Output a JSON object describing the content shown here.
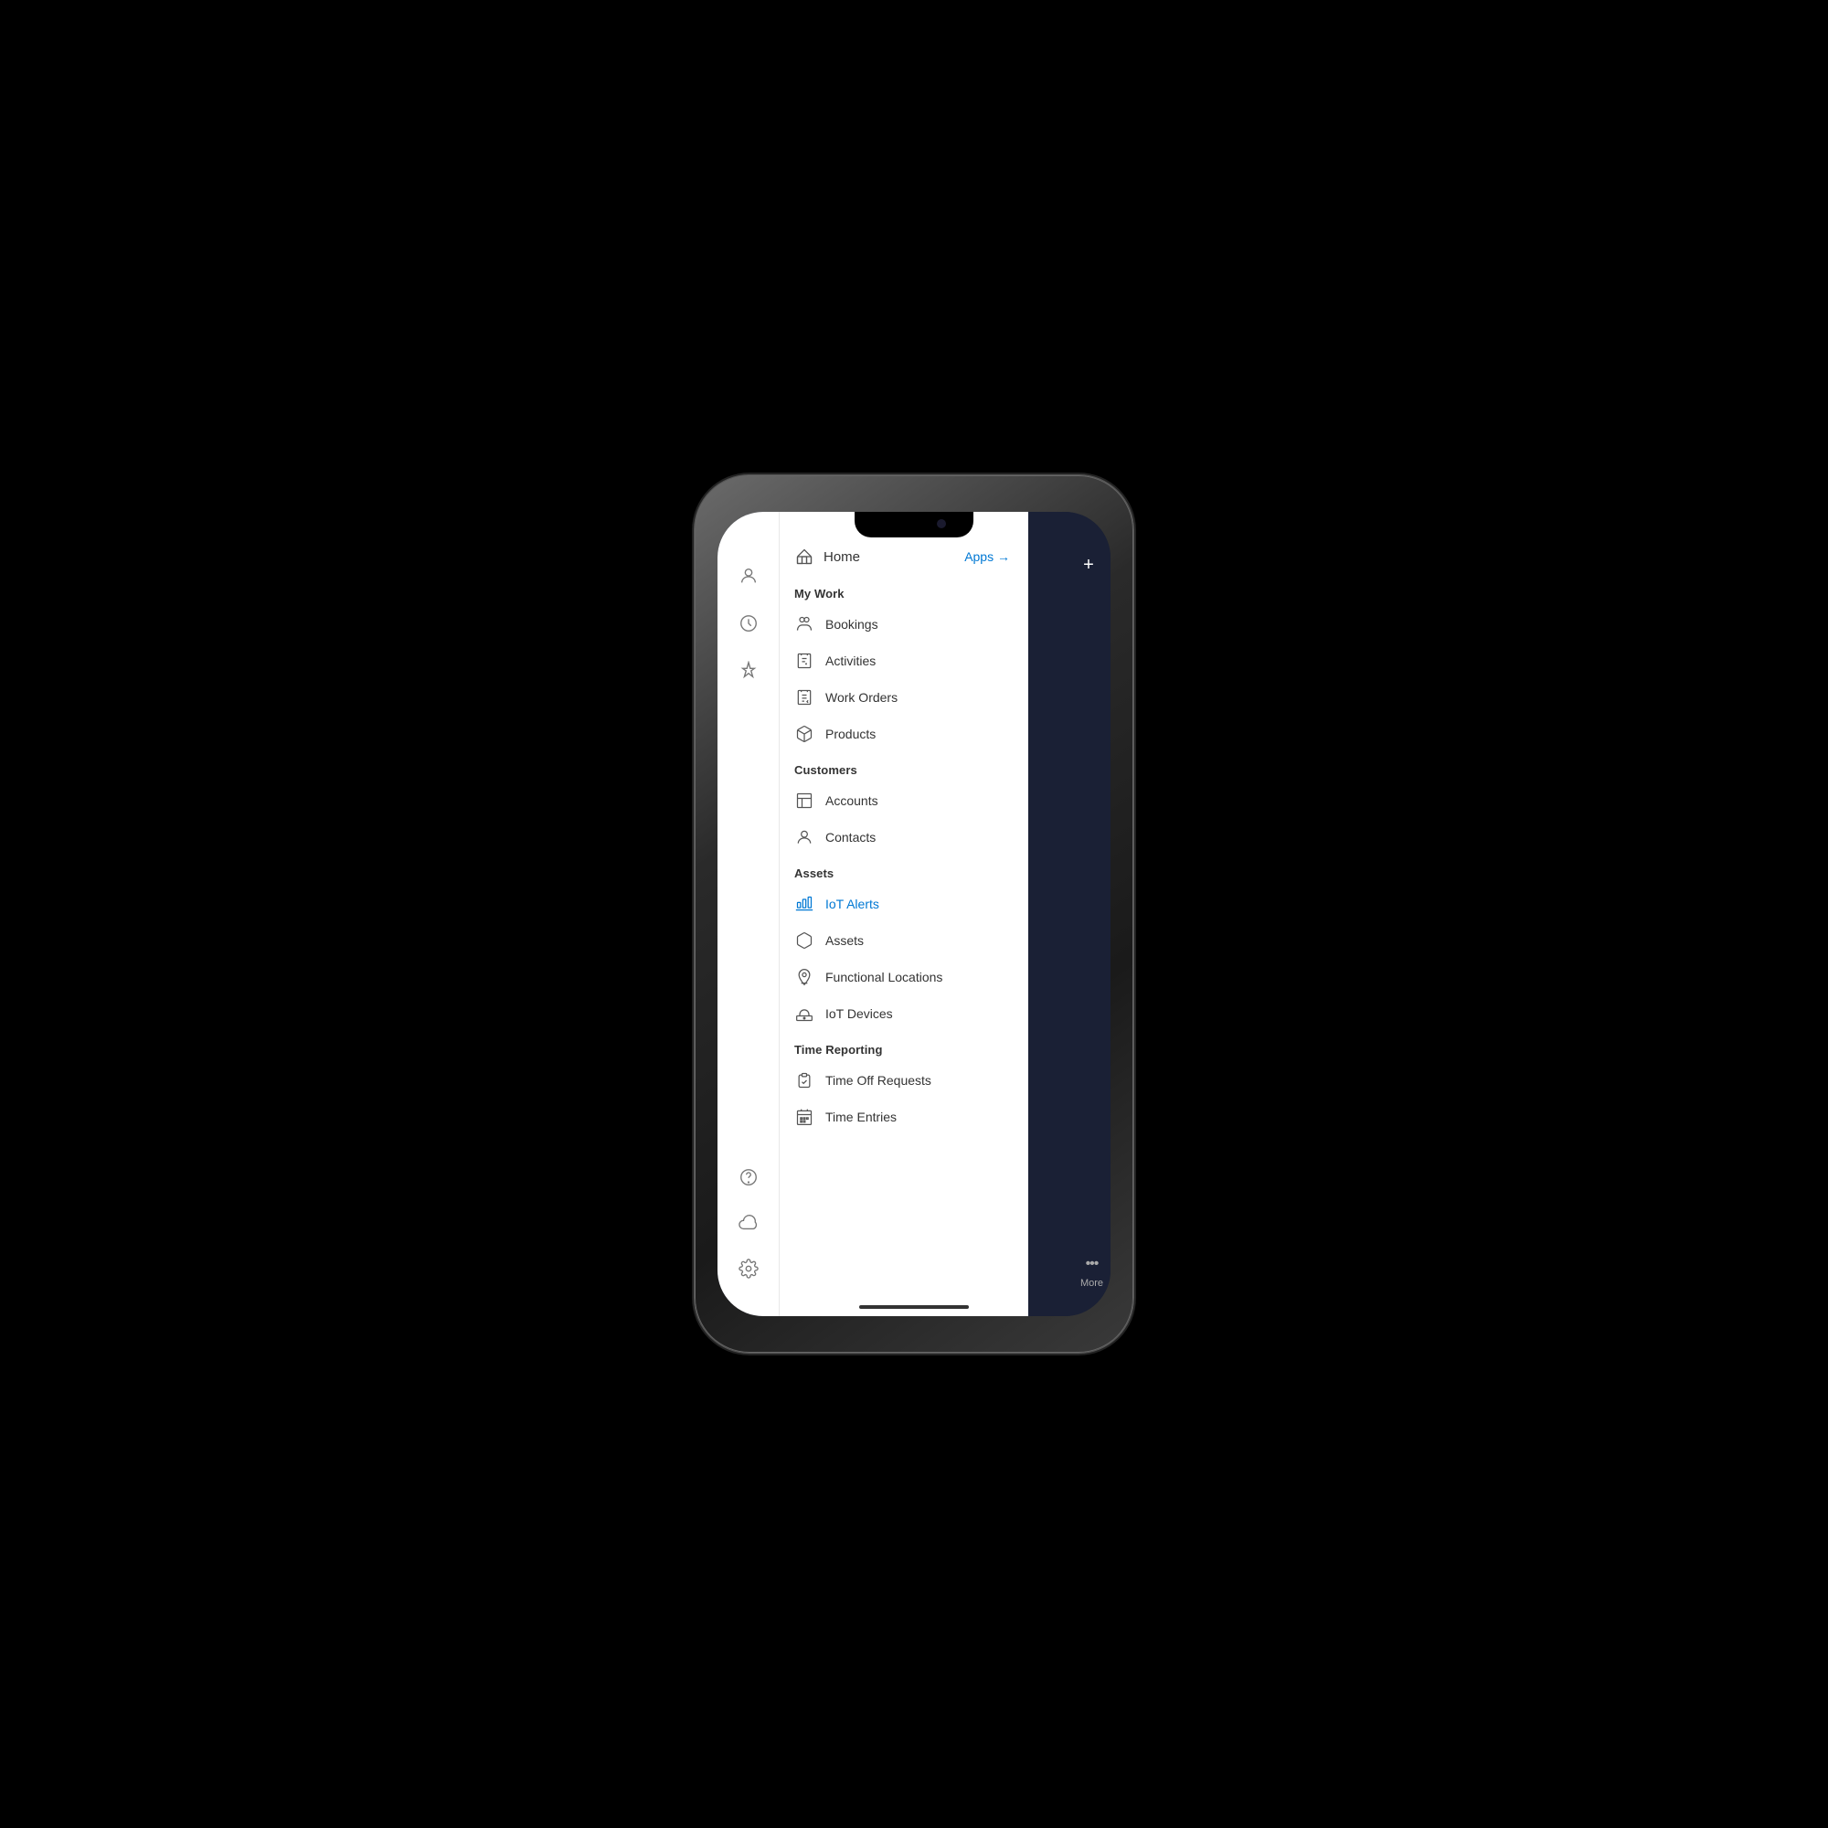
{
  "phone": {
    "notch": true
  },
  "header": {
    "home_label": "Home",
    "apps_label": "Apps →",
    "plus_label": "+"
  },
  "sidebar_icons": [
    {
      "name": "person-icon",
      "symbol": "👤"
    },
    {
      "name": "clock-icon",
      "symbol": "🕐"
    },
    {
      "name": "pin-icon",
      "symbol": "📌"
    }
  ],
  "sidebar_bottom_icons": [
    {
      "name": "help-icon",
      "symbol": "?"
    },
    {
      "name": "cloud-icon",
      "symbol": "☁"
    },
    {
      "name": "settings-icon",
      "symbol": "⚙"
    }
  ],
  "nav": {
    "my_work_label": "My Work",
    "customers_label": "Customers",
    "assets_label": "Assets",
    "time_reporting_label": "Time Reporting",
    "items": [
      {
        "id": "bookings",
        "label": "Bookings",
        "icon": "bookings-icon",
        "active": false
      },
      {
        "id": "activities",
        "label": "Activities",
        "icon": "activities-icon",
        "active": false
      },
      {
        "id": "work-orders",
        "label": "Work Orders",
        "icon": "work-orders-icon",
        "active": false
      },
      {
        "id": "products",
        "label": "Products",
        "icon": "products-icon",
        "active": false
      },
      {
        "id": "accounts",
        "label": "Accounts",
        "icon": "accounts-icon",
        "active": false
      },
      {
        "id": "contacts",
        "label": "Contacts",
        "icon": "contacts-icon",
        "active": false
      },
      {
        "id": "iot-alerts",
        "label": "IoT Alerts",
        "icon": "iot-alerts-icon",
        "active": true
      },
      {
        "id": "assets",
        "label": "Assets",
        "icon": "assets-icon",
        "active": false
      },
      {
        "id": "functional-locations",
        "label": "Functional Locations",
        "icon": "functional-locations-icon",
        "active": false
      },
      {
        "id": "iot-devices",
        "label": "IoT Devices",
        "icon": "iot-devices-icon",
        "active": false
      },
      {
        "id": "time-off-requests",
        "label": "Time Off Requests",
        "icon": "time-off-requests-icon",
        "active": false
      },
      {
        "id": "time-entries",
        "label": "Time Entries",
        "icon": "time-entries-icon",
        "active": false
      }
    ]
  },
  "panel": {
    "more_label": "More"
  }
}
